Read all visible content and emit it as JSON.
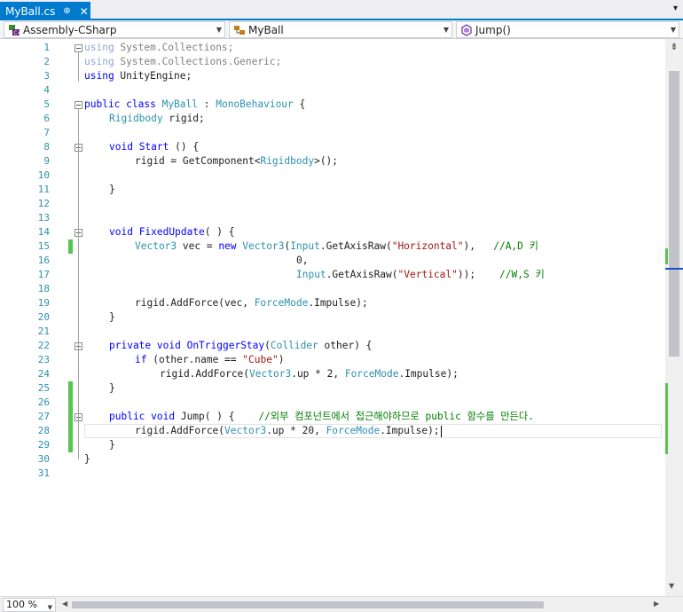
{
  "tab": {
    "title": "MyBall.cs",
    "pin_glyph": "⊕",
    "close_glyph": "✕",
    "overflow_glyph": "▾"
  },
  "nav": {
    "project": "Assembly-CSharp",
    "class": "MyBall",
    "member": "Jump()",
    "project_icon": "csharp-project-icon",
    "class_icon": "class-icon",
    "member_icon": "method-icon"
  },
  "editor": {
    "line_numbers": [
      "1",
      "2",
      "3",
      "4",
      "5",
      "6",
      "7",
      "8",
      "9",
      "10",
      "11",
      "12",
      "13",
      "14",
      "15",
      "16",
      "17",
      "18",
      "19",
      "20",
      "21",
      "22",
      "23",
      "24",
      "25",
      "26",
      "27",
      "28",
      "29",
      "30",
      "31"
    ],
    "changed_lines": [
      15,
      25,
      26,
      27,
      28,
      29
    ],
    "caret_line": 28
  },
  "code": {
    "l1": {
      "kw": "using",
      "rest": " System.Collections;"
    },
    "l2": {
      "kw": "using",
      "rest": " System.Collections.Generic;"
    },
    "l3": {
      "kw": "using",
      "rest": " UnityEngine;"
    },
    "l5": {
      "kw1": "public",
      "kw2": " class",
      "name": " MyBall",
      "sep": " : ",
      "base": "MonoBehaviour",
      "brace": " {"
    },
    "l6": {
      "ty": "Rigidbody",
      "rest": " rigid;"
    },
    "l8": {
      "kw": "void",
      "name": " Start ",
      "rest": "() {"
    },
    "l9": {
      "a": "rigid = GetComponent<",
      "ty": "Rigidbody",
      "b": ">();"
    },
    "l11": {
      "t": "}"
    },
    "l14": {
      "kw": "void",
      "name": " FixedUpdate",
      "rest": "( ) {"
    },
    "l15": {
      "ty1": "Vector3",
      "a": " vec = ",
      "kw": "new",
      "sp": " ",
      "ty2": "Vector3",
      "b": "(",
      "ty3": "Input",
      "c": ".GetAxisRaw(",
      "str": "\"Horizontal\"",
      "d": "),   ",
      "cm": "//A,D 키"
    },
    "l16": {
      "t": "0,"
    },
    "l17": {
      "ty": "Input",
      "a": ".GetAxisRaw(",
      "str": "\"Vertical\"",
      "b": "));    ",
      "cm": "//W,S 키"
    },
    "l19": {
      "a": "rigid.AddForce(vec, ",
      "ty": "ForceMode",
      "b": ".Impulse);"
    },
    "l20": {
      "t": "}"
    },
    "l22": {
      "kw1": "private",
      "kw2": " void",
      "name": " OnTriggerStay",
      "a": "(",
      "ty": "Collider",
      "b": " other) {"
    },
    "l23": {
      "kw": "if",
      "a": " (other.name == ",
      "str": "\"Cube\"",
      "b": ")"
    },
    "l24": {
      "a": "rigid.AddForce(",
      "ty1": "Vector3",
      "b": ".up * 2, ",
      "ty2": "ForceMode",
      "c": ".Impulse);"
    },
    "l25": {
      "t": "}"
    },
    "l27": {
      "kw1": "public",
      "kw2": " void",
      "name": " Jump",
      "a": "( ) {    ",
      "cm": "//외부 컴포넌트에서 접근해야하므로 public 함수를 만든다."
    },
    "l28": {
      "a": "rigid.AddForce(",
      "ty1": "Vector3",
      "b": ".up * 20, ",
      "ty2": "ForceMode",
      "c": ".Impulse);"
    },
    "l29": {
      "t": "}"
    },
    "l30": {
      "t": "}"
    }
  },
  "status": {
    "zoom": "100 %"
  },
  "colors": {
    "accent": "#007acc",
    "keyword": "#0000ff",
    "type": "#2b91af",
    "string": "#a31515",
    "comment": "#008000",
    "change_marker": "#57c54f"
  }
}
